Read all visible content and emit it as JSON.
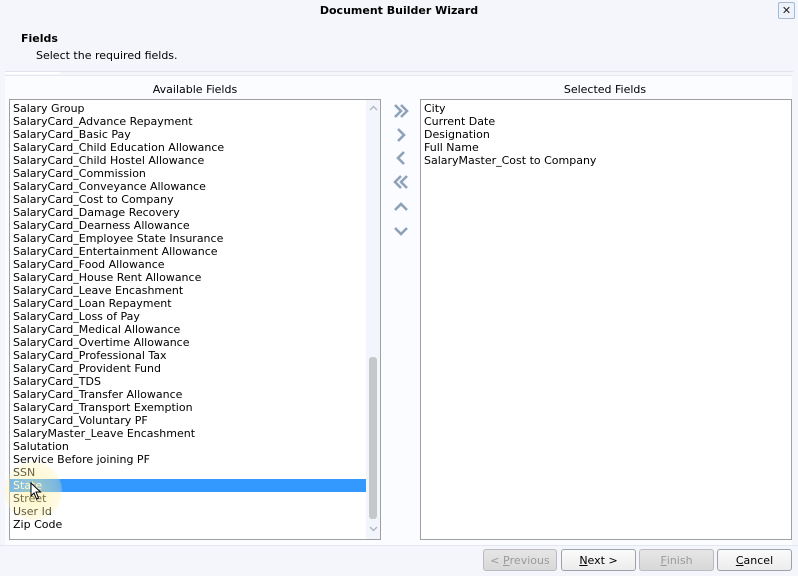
{
  "window": {
    "title": "Document Builder Wizard",
    "close_icon": "close-icon"
  },
  "header": {
    "title": "Fields",
    "subtitle": "Select the required fields."
  },
  "available": {
    "label": "Available Fields",
    "selected_index": 29,
    "items": [
      "Salary Group",
      "SalaryCard_Advance Repayment",
      "SalaryCard_Basic Pay",
      "SalaryCard_Child Education Allowance",
      "SalaryCard_Child Hostel Allowance",
      "SalaryCard_Commission",
      "SalaryCard_Conveyance Allowance",
      "SalaryCard_Cost to Company",
      "SalaryCard_Damage Recovery",
      "SalaryCard_Dearness Allowance",
      "SalaryCard_Employee State Insurance",
      "SalaryCard_Entertainment Allowance",
      "SalaryCard_Food Allowance",
      "SalaryCard_House Rent Allowance",
      "SalaryCard_Leave Encashment",
      "SalaryCard_Loan Repayment",
      "SalaryCard_Loss of Pay",
      "SalaryCard_Medical Allowance",
      "SalaryCard_Overtime Allowance",
      "SalaryCard_Professional Tax",
      "SalaryCard_Provident Fund",
      "SalaryCard_TDS",
      "SalaryCard_Transfer Allowance",
      "SalaryCard_Transport Exemption",
      "SalaryCard_Voluntary PF",
      "SalaryMaster_Leave Encashment",
      "Salutation",
      "Service Before joining PF",
      "SSN",
      "State",
      "Street",
      "User Id",
      "Zip Code"
    ]
  },
  "selected": {
    "label": "Selected Fields",
    "items": [
      "City",
      "Current Date",
      "Designation",
      "Full Name",
      "SalaryMaster_Cost to Company"
    ]
  },
  "transfer_buttons": [
    {
      "name": "add-all-button",
      "icon": "double-chevron-right-icon"
    },
    {
      "name": "add-button",
      "icon": "chevron-right-icon"
    },
    {
      "name": "remove-button",
      "icon": "chevron-left-icon"
    },
    {
      "name": "remove-all-button",
      "icon": "double-chevron-left-icon"
    },
    {
      "name": "move-up-button",
      "icon": "chevron-up-icon"
    },
    {
      "name": "move-down-button",
      "icon": "chevron-down-icon"
    }
  ],
  "footer": {
    "previous": {
      "prefix": "< ",
      "mnemonic": "P",
      "rest": "revious",
      "enabled": false
    },
    "next": {
      "mnemonic": "N",
      "rest": "ext >",
      "enabled": true
    },
    "finish": {
      "mnemonic": "F",
      "rest": "inish",
      "enabled": false
    },
    "cancel": {
      "mnemonic": "C",
      "rest": "ancel",
      "enabled": true
    }
  }
}
